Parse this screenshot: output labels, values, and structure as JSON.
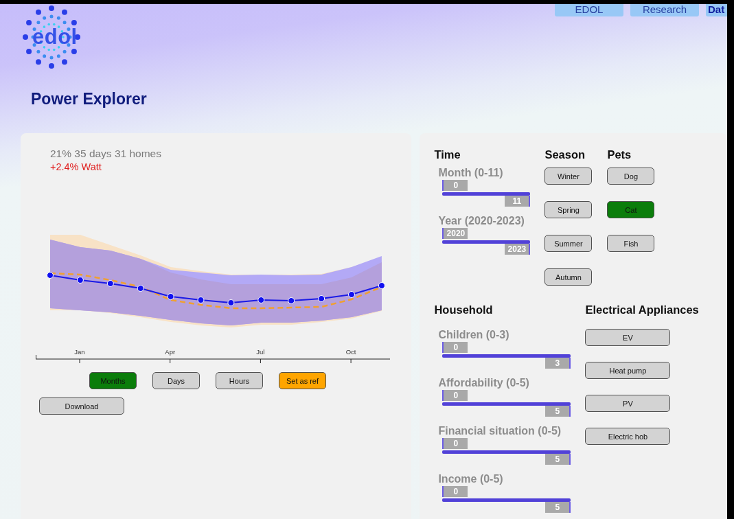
{
  "nav": [
    {
      "label": "EDOL"
    },
    {
      "label": "Research"
    },
    {
      "label": "Dat",
      "selected": true
    }
  ],
  "logo": {
    "text": "edol"
  },
  "page_title": "Power Explorer",
  "summary": {
    "stats": "21% 35 days 31 homes",
    "change": "+2.4% Watt"
  },
  "chart": {
    "axis_labels": [
      "Jan",
      "Apr",
      "Jul",
      "Oct"
    ]
  },
  "view_buttons": [
    {
      "label": "Months",
      "kind": "toggle",
      "selected": true
    },
    {
      "label": "Days",
      "kind": "toggle",
      "selected": false
    },
    {
      "label": "Hours",
      "kind": "toggle",
      "selected": false
    },
    {
      "label": "Set as ref",
      "kind": "action"
    }
  ],
  "download_button": "Download",
  "time": {
    "title": "Time",
    "sliders": [
      {
        "label": "Month (0-11)",
        "low": "0",
        "high": "11",
        "level": 1
      },
      {
        "label": "Year (2020-2023)",
        "low": "2020",
        "high": "2023",
        "level": 1
      }
    ]
  },
  "season": {
    "title": "Season",
    "options": [
      {
        "label": "Winter",
        "selected": false
      },
      {
        "label": "Spring",
        "selected": false
      },
      {
        "label": "Summer",
        "selected": false
      },
      {
        "label": "Autumn",
        "selected": false
      }
    ]
  },
  "pets": {
    "title": "Pets",
    "options": [
      {
        "label": "Dog",
        "selected": false
      },
      {
        "label": "Cat",
        "selected": true
      },
      {
        "label": "Fish",
        "selected": false
      }
    ]
  },
  "household": {
    "title": "Household",
    "sliders": [
      {
        "label": "Children (0-3)",
        "low": "0",
        "high": "3",
        "level": 1
      },
      {
        "label": "Affordability (0-5)",
        "low": "0",
        "high": "5",
        "level": 1
      },
      {
        "label": "Financial situation (0-5)",
        "low": "0",
        "high": "5",
        "level": 1
      },
      {
        "label": "Income (0-5)",
        "low": "0",
        "high": "5",
        "level": 1
      }
    ]
  },
  "appliances": {
    "title": "Electrical Appliances",
    "options": [
      {
        "label": "EV",
        "selected": false
      },
      {
        "label": "Heat pump",
        "selected": false
      },
      {
        "label": "PV",
        "selected": false
      },
      {
        "label": "Electric hob",
        "selected": false
      }
    ]
  }
}
